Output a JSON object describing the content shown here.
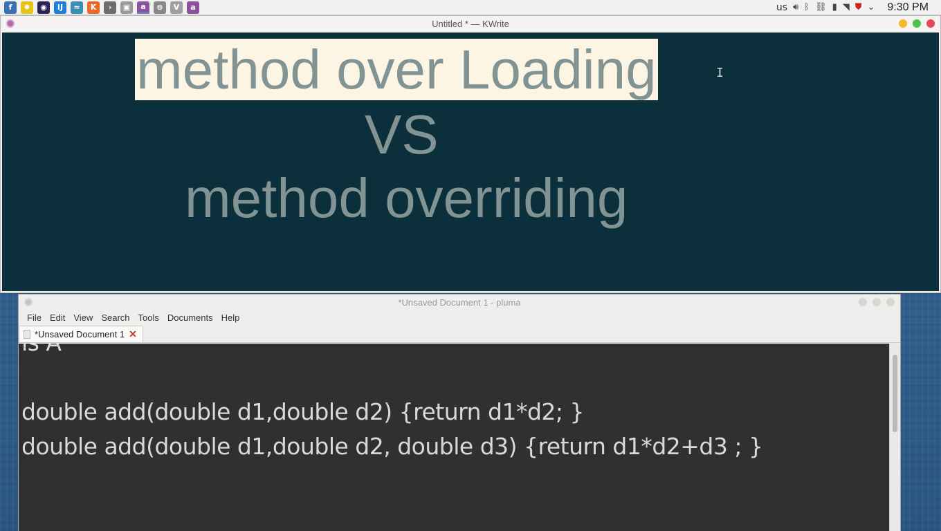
{
  "panel": {
    "launchers": [
      {
        "name": "fedora-icon",
        "glyph": "f",
        "color": "#3c6eb4"
      },
      {
        "name": "paint-icon",
        "glyph": "✸",
        "color": "#e8c21b"
      },
      {
        "name": "eclipse-icon",
        "glyph": "◉",
        "color": "#2c2255"
      },
      {
        "name": "intellij-icon",
        "glyph": "IJ",
        "color": "#1f7dd6"
      },
      {
        "name": "bird-icon",
        "glyph": "≈",
        "color": "#3b8fb7"
      },
      {
        "name": "kolourpaint-icon",
        "glyph": "K",
        "color": "#e86a2a"
      },
      {
        "name": "terminal-icon",
        "glyph": "›",
        "color": "#6d6d6d"
      },
      {
        "name": "image-viewer-icon",
        "glyph": "▣",
        "color": "#9a9a9a"
      },
      {
        "name": "app-icon-purple-1",
        "glyph": "a",
        "color": "#8c52a0"
      },
      {
        "name": "disk-icon",
        "glyph": "⊜",
        "color": "#888888"
      },
      {
        "name": "vim-icon",
        "glyph": "V",
        "color": "#a0a0a0"
      },
      {
        "name": "app-icon-purple-2",
        "glyph": "a",
        "color": "#8c52a0"
      }
    ],
    "keyboard_layout": "us",
    "clock": "9:30 PM"
  },
  "kwrite": {
    "title": "Untitled * — KWrite",
    "lines": [
      "method over Loading",
      "VS",
      "method overriding"
    ],
    "background_color": "#0b303b",
    "text_color": "#829394",
    "selection_color": "#fdf5e3"
  },
  "pluma": {
    "title": "*Unsaved Document 1 - pluma",
    "menu": [
      "File",
      "Edit",
      "View",
      "Search",
      "Tools",
      "Documents",
      "Help"
    ],
    "tab_label": "*Unsaved Document 1",
    "lines": [
      "is A",
      "",
      "double add(double d1,double d2) {return d1*d2; }",
      "double add(double d1,double d2, double d3) {return d1*d2+d3 ; }"
    ]
  }
}
